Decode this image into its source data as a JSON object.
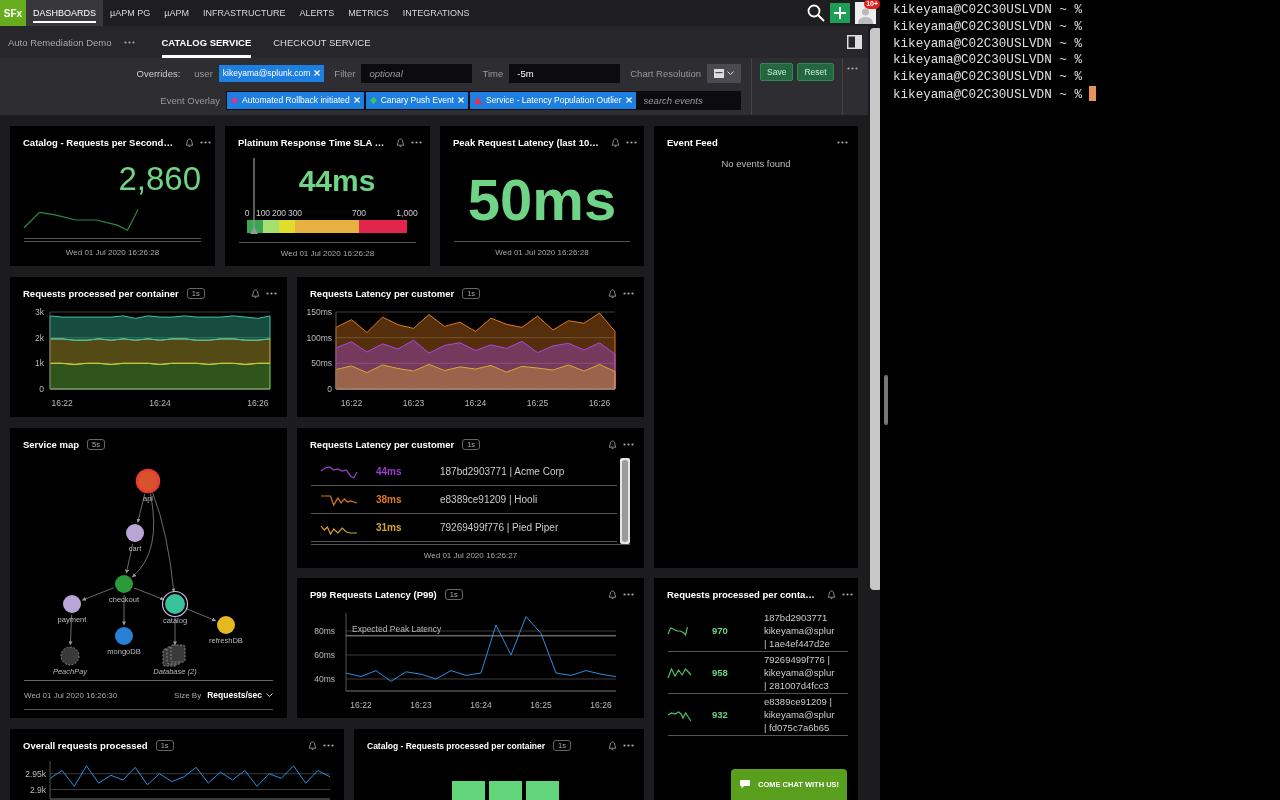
{
  "nav": {
    "logo": "SFx",
    "items": [
      {
        "label": "DASHBOARDS",
        "selected": true
      },
      {
        "label": "µAPM PG",
        "selected": false
      },
      {
        "label": "µAPM",
        "selected": false
      },
      {
        "label": "INFRASTRUCTURE",
        "selected": false
      },
      {
        "label": "ALERTS",
        "selected": false
      },
      {
        "label": "METRICS",
        "selected": false
      },
      {
        "label": "INTEGRATIONS",
        "selected": false
      }
    ],
    "notification_badge": "10+"
  },
  "dashboard_bar": {
    "group": "Auto Remediation Demo",
    "tabs": [
      {
        "label": "CATALOG SERVICE",
        "selected": true
      },
      {
        "label": "CHECKOUT SERVICE",
        "selected": false
      }
    ]
  },
  "filters": {
    "overrides_label": "Overrides:",
    "user_label": "user",
    "user_value": "kikeyama@splunk.com",
    "filter_label": "Filter",
    "filter_placeholder": "optional",
    "time_label": "Time",
    "time_value": "-5m",
    "resolution_label": "Chart Resolution",
    "event_overlay_label": "Event Overlay",
    "events": [
      {
        "label": "Automated Rollback initiated",
        "kind": "diamond",
        "color": "#e0338a"
      },
      {
        "label": "Canary Push Event",
        "kind": "diamond",
        "color": "#3cc65a"
      },
      {
        "label": "Service - Latency Population Outlier",
        "kind": "triangle",
        "color": "#e8304a"
      }
    ],
    "event_search_placeholder": "search events",
    "buttons": [
      "Save",
      "Reset"
    ]
  },
  "cards": [
    {
      "kind": "single_value",
      "title": "Catalog - Requests per Second…",
      "bell": true,
      "menu": true,
      "value": "2,860",
      "timestamp": "Wed 01 Jul 2020 16:26:28"
    },
    {
      "kind": "gauge",
      "title": "Platinum Response Time SLA …",
      "bell": true,
      "menu": true,
      "value": "44ms",
      "level": 0.044,
      "ticks": [
        "0",
        "100",
        "200",
        "300",
        "700",
        "1,000"
      ],
      "bands": [
        {
          "color": "#3aa655"
        },
        {
          "color": "#a6e06e"
        },
        {
          "color": "#e2dc2c"
        },
        {
          "color": "#e8b040"
        },
        {
          "color": "#e0264a"
        }
      ],
      "timestamp": "Wed 01 Jul 2020 16:26:28"
    },
    {
      "kind": "big_value",
      "title": "Peak Request Latency (last 10…",
      "bell": true,
      "menu": true,
      "value": "50ms",
      "timestamp": "Wed 01 Jul 2020 16:26:28"
    },
    {
      "kind": "event_feed",
      "title": "Event Feed",
      "bell": false,
      "menu": true,
      "message": "No events found"
    },
    {
      "kind": "chart",
      "title": "Requests processed per container",
      "resolution": "1s",
      "bell": true,
      "menu": true,
      "chart_data": {
        "type": "area",
        "stacked": true,
        "grid": true,
        "ylim": [
          0,
          3000
        ],
        "categories": [
          null,
          "16:22",
          null,
          null,
          null,
          null,
          null,
          null,
          null,
          "16:24",
          null,
          null,
          null,
          null,
          null,
          null,
          null,
          "16:26",
          null
        ],
        "yticks": [
          0,
          {
            "value": 1000,
            "label": "1k"
          },
          {
            "value": 2000,
            "label": "2k"
          },
          {
            "value": 3000,
            "label": "3k"
          }
        ],
        "series": [
          {
            "color": "#7fe04a",
            "values": [
              1000,
              1000,
              950,
              1000,
              1000,
              950,
              1000,
              1000,
              1000,
              950,
              1000,
              1000,
              1000,
              950,
              1000,
              1000,
              950,
              1000,
              1000
            ]
          },
          {
            "color": "#d9c23a",
            "values": [
              950,
              950,
              950,
              900,
              950,
              950,
              950,
              900,
              950,
              950,
              950,
              950,
              900,
              950,
              950,
              950,
              950,
              900,
              950
            ]
          },
          {
            "color": "#3cc9a8",
            "values": [
              900,
              850,
              900,
              900,
              850,
              900,
              900,
              850,
              900,
              900,
              850,
              900,
              900,
              900,
              850,
              900,
              900,
              850,
              900
            ]
          }
        ]
      }
    },
    {
      "kind": "chart",
      "title": "Requests Latency per customer",
      "resolution": "1s",
      "bell": true,
      "menu": true,
      "chart_data": {
        "type": "area",
        "stacked": false,
        "grid": true,
        "ylim": [
          0,
          150
        ],
        "categories": [
          null,
          "16:22",
          null,
          null,
          null,
          "16:23",
          null,
          null,
          null,
          "16:24",
          null,
          null,
          null,
          "16:25",
          null,
          null,
          null,
          "16:26",
          null
        ],
        "yticks": [
          0,
          {
            "value": 50,
            "label": "50ms"
          },
          {
            "value": 100,
            "label": "100ms"
          },
          {
            "value": 150,
            "label": "150ms"
          }
        ],
        "series": [
          {
            "color": "#e07a1f",
            "values": [
              120,
              135,
              110,
              140,
              125,
              118,
              145,
              122,
              130,
              112,
              138,
              126,
              120,
              142,
              115,
              133,
              128,
              148,
              112
            ]
          },
          {
            "color": "#a94be0",
            "values": [
              80,
              92,
              72,
              88,
              78,
              95,
              70,
              85,
              90,
              75,
              86,
              79,
              93,
              71,
              84,
              89,
              76,
              90,
              68
            ]
          },
          {
            "color": "#d9a832",
            "values": [
              38,
              45,
              32,
              47,
              40,
              35,
              48,
              36,
              43,
              39,
              46,
              33,
              44,
              41,
              37,
              47,
              35,
              48,
              34
            ]
          }
        ]
      }
    },
    {
      "kind": "service_map",
      "title": "Service map",
      "resolution": "5s",
      "bell": false,
      "menu": false,
      "nodes": [
        {
          "label": "api",
          "kind": "service",
          "color": "#d8532a",
          "alert": true,
          "selected": false
        },
        {
          "label": "cart",
          "kind": "service",
          "color": "#b9a6d6",
          "alert": false,
          "selected": false
        },
        {
          "label": "checkout",
          "kind": "service",
          "color": "#2a9a3a",
          "alert": false,
          "selected": false
        },
        {
          "label": "payment",
          "kind": "service",
          "color": "#b9a6d6",
          "alert": false,
          "selected": false
        },
        {
          "label": "mongoDB",
          "kind": "service",
          "color": "#2a7fd6",
          "alert": false,
          "selected": false
        },
        {
          "label": "catalog",
          "kind": "service",
          "color": "#3ac39a",
          "alert": false,
          "selected": true
        },
        {
          "label": "refreshDB",
          "kind": "service",
          "color": "#e6b820",
          "alert": false,
          "selected": false
        },
        {
          "label": "PeachPay",
          "kind": "external",
          "color": "#3a3a3c",
          "alert": false,
          "selected": false
        },
        {
          "label": "Database (2)",
          "kind": "database",
          "color": "#3a3a3c",
          "alert": false,
          "selected": false
        }
      ],
      "timestamp": "Wed 01 Jul 2020 16:26:30",
      "size_by_label": "Size By",
      "size_by_value": "Requests/sec"
    },
    {
      "kind": "list",
      "title": "Requests Latency per customer",
      "resolution": "1s",
      "bell": true,
      "menu": true,
      "rows": [
        {
          "value": "44ms",
          "name": "187bd2903771 | Acme Corp",
          "color": "#9b3fd0"
        },
        {
          "value": "38ms",
          "name": "e8389ce91209 | Hooli",
          "color": "#e0761f"
        },
        {
          "value": "31ms",
          "name": "79269499f776 | Pied Piper",
          "color": "#d6a42a"
        }
      ],
      "timestamp": "Wed 01 Jul 2020 16:26:27"
    },
    {
      "kind": "chart",
      "title": "P99 Requests Latency (P99)",
      "resolution": "1s",
      "bell": true,
      "menu": true,
      "chart_data": {
        "type": "line",
        "grid": true,
        "ylim": [
          30,
          95
        ],
        "categories": [
          null,
          "16:22",
          null,
          null,
          null,
          "16:23",
          null,
          null,
          null,
          "16:24",
          null,
          null,
          null,
          "16:25",
          null,
          null,
          null,
          "16:26",
          null
        ],
        "yticks": [
          {
            "value": 40,
            "label": "40ms"
          },
          {
            "value": 60,
            "label": "60ms"
          },
          {
            "value": 80,
            "label": "80ms"
          }
        ],
        "series": [
          {
            "color": "#2a8fe0",
            "values": [
              45,
              42,
              47,
              38,
              46,
              44,
              40,
              47,
              43,
              45,
              85,
              60,
              92,
              78,
              45,
              43,
              47,
              44,
              42
            ]
          }
        ],
        "ref_lines": [
          {
            "axis": "y",
            "value": 76,
            "label": "Expected Peak Latency"
          }
        ]
      }
    },
    {
      "kind": "value_list",
      "title": "Requests processed per conta…",
      "bell": true,
      "menu": true,
      "rows": [
        {
          "value": "970",
          "lines": [
            "187bd2903771",
            "kikeyama@splur",
            "| 1ae4ef447d2e"
          ]
        },
        {
          "value": "958",
          "lines": [
            "79269499f776 |",
            "kikeyama@splur",
            "| 281007d4fcc3"
          ]
        },
        {
          "value": "932",
          "lines": [
            "e8389ce91209 |",
            "kikeyama@splur",
            "| fd075c7a6b65"
          ]
        }
      ]
    },
    {
      "kind": "chart",
      "title": "Overall requests processed",
      "resolution": "1s",
      "bell": true,
      "menu": true,
      "chart_data": {
        "type": "line",
        "grid": true,
        "ylim": [
          2870,
          2990
        ],
        "yticks": [
          {
            "value": 2900,
            "label": "2.9k"
          },
          {
            "value": 2950,
            "label": "2.95k"
          }
        ],
        "series": [
          {
            "color": "#2a8fe0",
            "values": [
              2935,
              2960,
              2910,
              2975,
              2920,
              2945,
              2930,
              2970,
              2915,
              2950,
              2925,
              2940,
              2970,
              2920,
              2955,
              2930,
              2960,
              2910,
              2950,
              2935,
              2975,
              2920,
              2960,
              2940
            ]
          }
        ]
      }
    },
    {
      "kind": "heatmap",
      "title": "Catalog - Requests processed per container",
      "resolution": "1s",
      "bell": true,
      "menu": true,
      "tiles": [
        {
          "color": "#62d57a"
        },
        {
          "color": "#62d57a"
        },
        {
          "color": "#62d57a"
        }
      ]
    }
  ],
  "chat_button": {
    "label": "COME CHAT WITH US!"
  },
  "terminal": {
    "lines": [
      "kikeyama@C02C30USLVDN ~ %",
      "kikeyama@C02C30USLVDN ~ %",
      "kikeyama@C02C30USLVDN ~ %",
      "kikeyama@C02C30USLVDN ~ %",
      "kikeyama@C02C30USLVDN ~ %",
      "kikeyama@C02C30USLVDN ~ %"
    ],
    "cursor": true
  }
}
